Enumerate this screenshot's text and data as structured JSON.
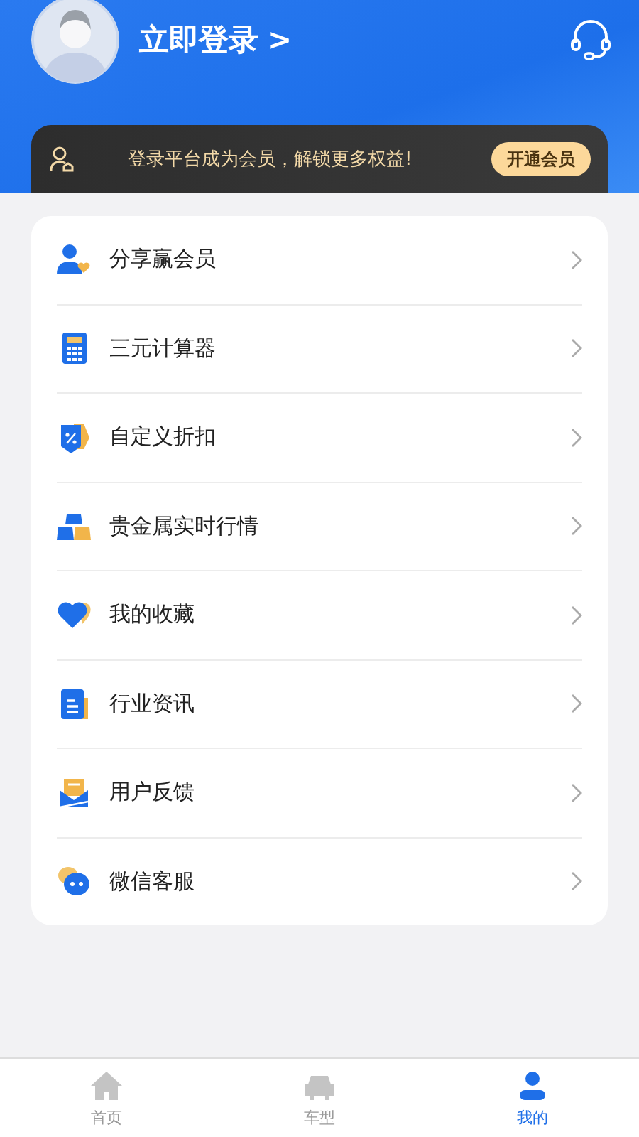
{
  "header": {
    "login_title": "立即登录",
    "login_arrow": ">"
  },
  "member_banner": {
    "message": "登录平台成为会员，解锁更多权益!",
    "button": "开通会员"
  },
  "menu": {
    "items": [
      {
        "label": "分享赢会员"
      },
      {
        "label": "三元计算器"
      },
      {
        "label": "自定义折扣"
      },
      {
        "label": "贵金属实时行情"
      },
      {
        "label": "我的收藏"
      },
      {
        "label": "行业资讯"
      },
      {
        "label": "用户反馈"
      },
      {
        "label": "微信客服"
      }
    ]
  },
  "tab_bar": [
    {
      "label": "首页",
      "selected": false
    },
    {
      "label": "车型",
      "selected": false
    },
    {
      "label": "我的",
      "selected": true
    }
  ]
}
